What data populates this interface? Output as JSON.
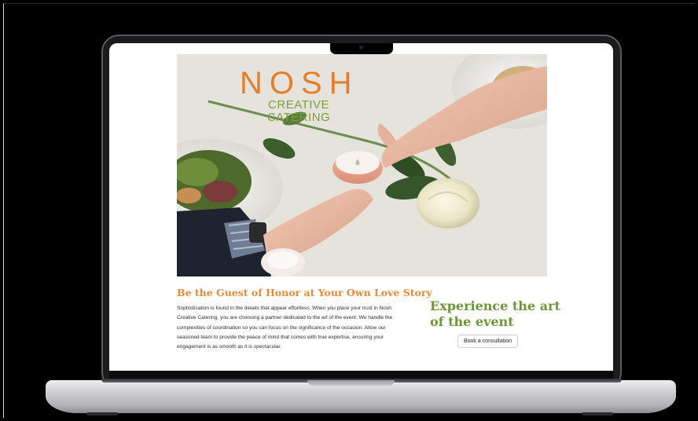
{
  "brand": {
    "name": "NOSH",
    "subtitle": "CREATIVE CATERING",
    "logo_color": "#e37f2c",
    "subtitle_color": "#7a9e3a"
  },
  "hero": {
    "image_alt": "hero-photo"
  },
  "content": {
    "headline": "Be the Guest of Honor at Your Own Love Story",
    "body": "Sophistication is found in the details that appear effortless. When you place your trust in Nosh Creative Catering, you are choosing a partner dedicated to the art of the event. We handle the complexities of coordination so you can focus on the significance of the occasion. Allow our seasoned team to provide the peace of mind that comes with true expertise, ensuring your engagement is as smooth as it is spectacular.",
    "headline_color": "#e38a3b"
  },
  "cta": {
    "heading": "Experience the art of the event",
    "button_label": "Book a consultation",
    "heading_color": "#6d963a"
  }
}
